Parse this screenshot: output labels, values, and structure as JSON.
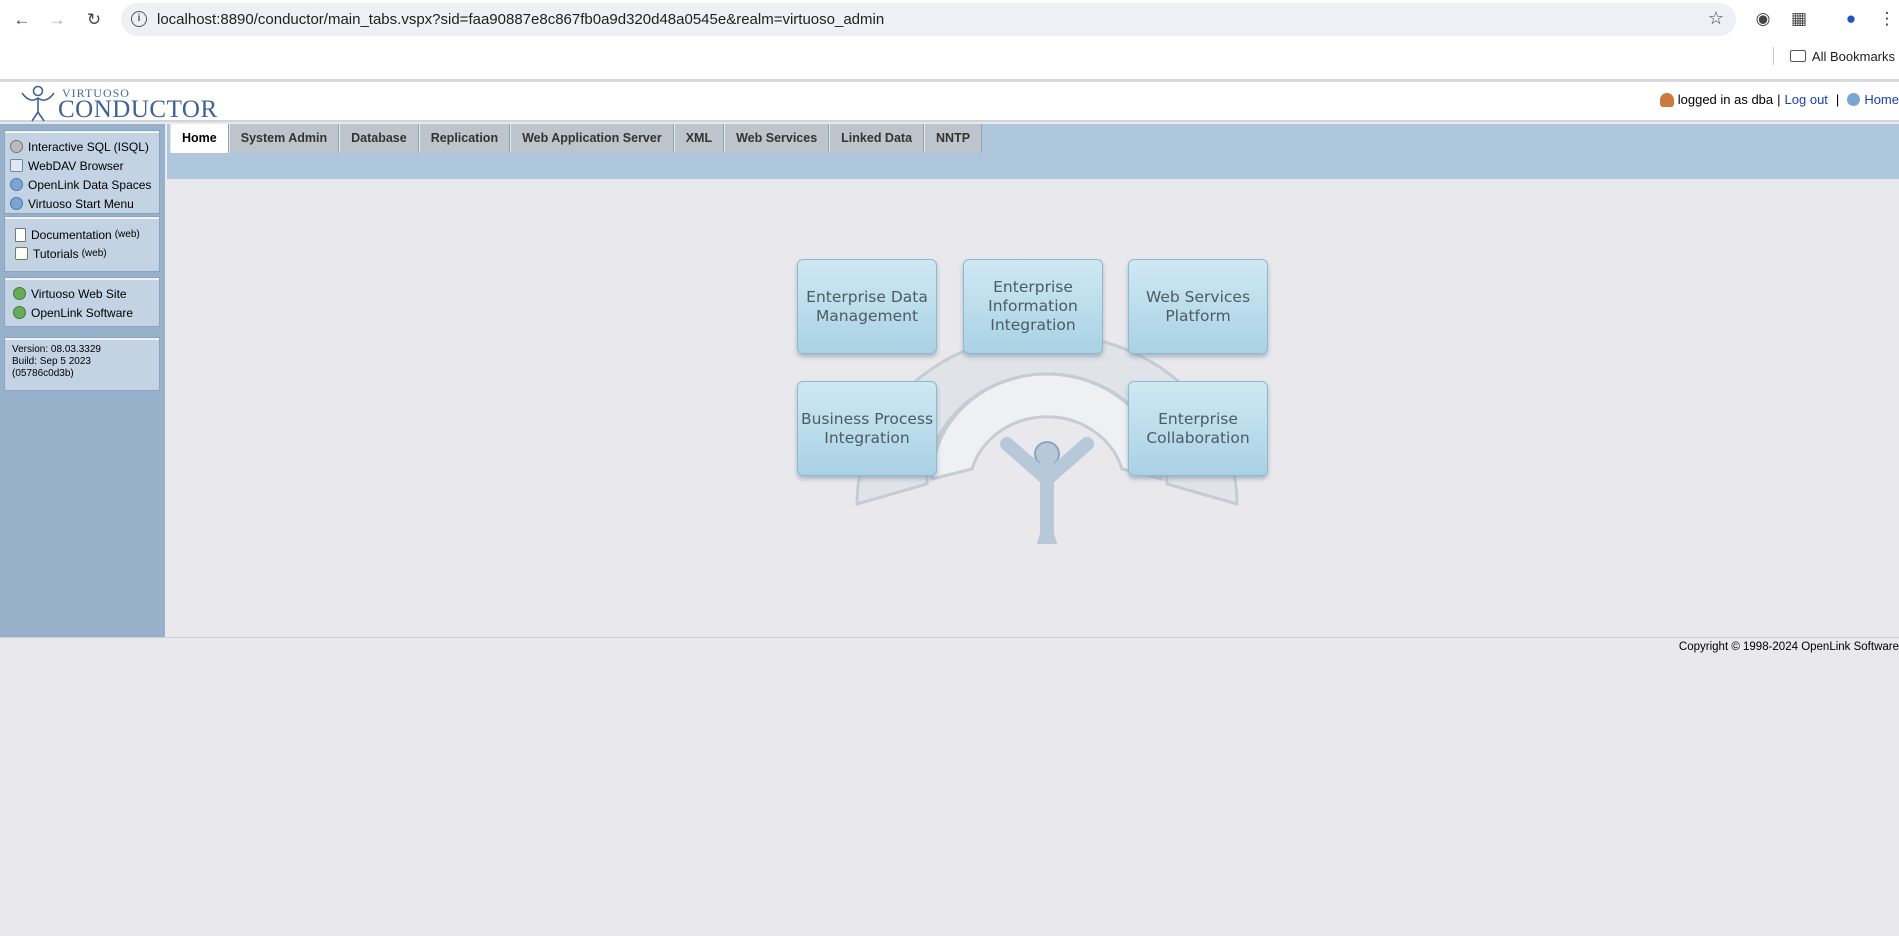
{
  "browser": {
    "url": "localhost:8890/conductor/main_tabs.vspx?sid=faa90887e8c867fb0a9d320d48a0545e&realm=virtuoso_admin",
    "bookmarks_label": "All Bookmarks"
  },
  "header": {
    "logo_top": "VIRTUOSO",
    "logo_main": "CONDUCTOR",
    "logged_in_text": "logged in as dba",
    "separator": "|",
    "logout_label": "Log out",
    "home_label": "Home"
  },
  "sidebar": {
    "tools": [
      {
        "label": "Interactive SQL (ISQL)",
        "icon": "gear-icon"
      },
      {
        "label": "WebDAV Browser",
        "icon": "folder-icon"
      },
      {
        "label": "OpenLink Data Spaces",
        "icon": "globe-icon"
      },
      {
        "label": "Virtuoso Start Menu",
        "icon": "globe-icon"
      }
    ],
    "docs": [
      {
        "label": "Documentation",
        "suffix": "(web)",
        "icon": "document-icon"
      },
      {
        "label": "Tutorials",
        "suffix": "(web)",
        "icon": "tutorial-icon"
      }
    ],
    "sites": [
      {
        "label": "Virtuoso Web Site",
        "icon": "globe-icon"
      },
      {
        "label": "OpenLink Software",
        "icon": "globe-icon"
      }
    ],
    "version": {
      "version_line": "Version: 08.03.3329",
      "build_line": "Build: Sep 5 2023",
      "hash_line": "(05786c0d3b)"
    }
  },
  "tabs": [
    "Home",
    "System Admin",
    "Database",
    "Replication",
    "Web Application Server",
    "XML",
    "Web Services",
    "Linked Data",
    "NNTP"
  ],
  "active_tab": "Home",
  "diagram": {
    "boxes": [
      "Enterprise Data Management",
      "Enterprise Information Integration",
      "Web Services Platform",
      "Business Process Integration",
      "Enterprise Collaboration"
    ]
  },
  "footer": {
    "copyright": "Copyright © 1998-2024 OpenLink Software"
  },
  "colors": {
    "sidebar_bg": "#96b1c9",
    "tabbar_bg": "#afc7dc",
    "page_bg": "#e9e8ed",
    "link": "#1a3fa8"
  }
}
